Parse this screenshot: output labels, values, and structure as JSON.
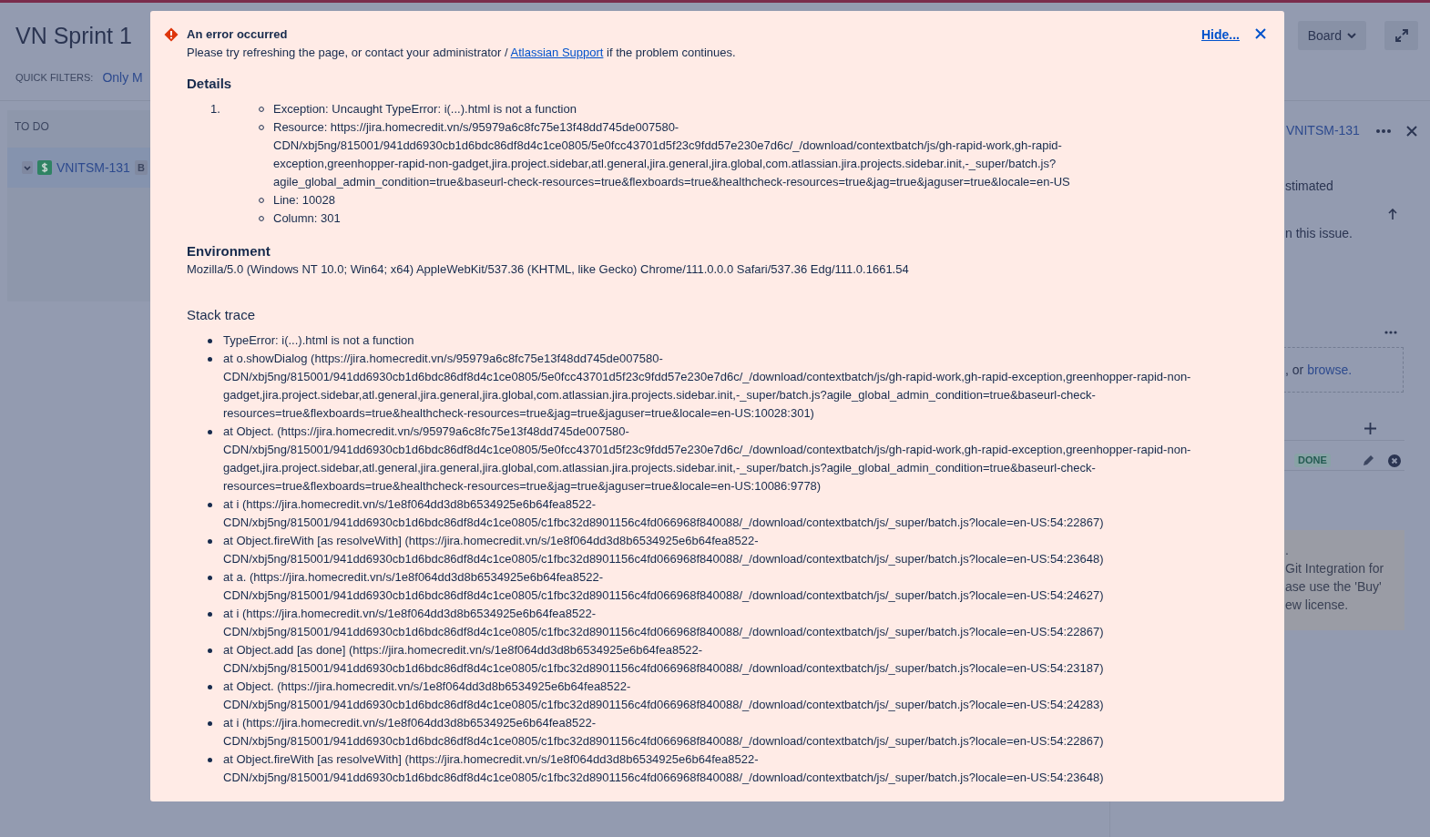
{
  "board": {
    "title": "VN Sprint 1",
    "view_button": "Board",
    "quick_filters_label": "QUICK FILTERS:",
    "quick_filter": "Only M",
    "column": "TO DO",
    "card": {
      "key": "VNITSM-131",
      "badge": "B"
    }
  },
  "detail_panel": {
    "issue_key": "VNITSM-131",
    "estimate_text": "stimated",
    "issue_text": "n this issue.",
    "attach_text": ", or",
    "attach_link": "browse.",
    "status": "DONE",
    "license_lines": [
      ".",
      "Git Integration for",
      "ase use the 'Buy'",
      "ew license."
    ]
  },
  "error": {
    "title": "An error occurred",
    "message_before": "Please try refreshing the page, or contact your administrator /",
    "link": "Atlassian Support",
    "message_after": "if the problem continues.",
    "hide": "Hide...",
    "details_heading": "Details",
    "details": [
      {
        "number": "1.",
        "items": [
          "Exception: Uncaught TypeError: i(...).html is not a function",
          "Resource: https://jira.homecredit.vn/s/95979a6c8fc75e13f48dd745de007580-CDN/xbj5ng/815001/941dd6930cb1d6bdc86df8d4c1ce0805/5e0fcc43701d5f23c9fdd57e230e7d6c/_/download/contextbatch/js/gh-rapid-work,gh-rapid-exception,greenhopper-rapid-non-gadget,jira.project.sidebar,atl.general,jira.general,jira.global,com.atlassian.jira.projects.sidebar.init,-_super/batch.js?agile_global_admin_condition=true&baseurl-check-resources=true&flexboards=true&healthcheck-resources=true&jag=true&jaguser=true&locale=en-US",
          "Line: 10028",
          "Column: 301"
        ]
      }
    ],
    "environment_heading": "Environment",
    "environment": "Mozilla/5.0 (Windows NT 10.0; Win64; x64) AppleWebKit/537.36 (KHTML, like Gecko) Chrome/111.0.0.0 Safari/537.36 Edg/111.0.1661.54",
    "stack_heading": "Stack trace",
    "stack": [
      "TypeError: i(...).html is not a function",
      "at o.showDialog (https://jira.homecredit.vn/s/95979a6c8fc75e13f48dd745de007580-CDN/xbj5ng/815001/941dd6930cb1d6bdc86df8d4c1ce0805/5e0fcc43701d5f23c9fdd57e230e7d6c/_/download/contextbatch/js/gh-rapid-work,gh-rapid-exception,greenhopper-rapid-non-gadget,jira.project.sidebar,atl.general,jira.general,jira.global,com.atlassian.jira.projects.sidebar.init,-_super/batch.js?agile_global_admin_condition=true&baseurl-check-resources=true&flexboards=true&healthcheck-resources=true&jag=true&jaguser=true&locale=en-US:10028:301)",
      "at Object. (https://jira.homecredit.vn/s/95979a6c8fc75e13f48dd745de007580-CDN/xbj5ng/815001/941dd6930cb1d6bdc86df8d4c1ce0805/5e0fcc43701d5f23c9fdd57e230e7d6c/_/download/contextbatch/js/gh-rapid-work,gh-rapid-exception,greenhopper-rapid-non-gadget,jira.project.sidebar,atl.general,jira.general,jira.global,com.atlassian.jira.projects.sidebar.init,-_super/batch.js?agile_global_admin_condition=true&baseurl-check-resources=true&flexboards=true&healthcheck-resources=true&jag=true&jaguser=true&locale=en-US:10086:9778)",
      "at i (https://jira.homecredit.vn/s/1e8f064dd3d8b6534925e6b64fea8522-CDN/xbj5ng/815001/941dd6930cb1d6bdc86df8d4c1ce0805/c1fbc32d8901156c4fd066968f840088/_/download/contextbatch/js/_super/batch.js?locale=en-US:54:22867)",
      "at Object.fireWith [as resolveWith] (https://jira.homecredit.vn/s/1e8f064dd3d8b6534925e6b64fea8522-CDN/xbj5ng/815001/941dd6930cb1d6bdc86df8d4c1ce0805/c1fbc32d8901156c4fd066968f840088/_/download/contextbatch/js/_super/batch.js?locale=en-US:54:23648)",
      "at a. (https://jira.homecredit.vn/s/1e8f064dd3d8b6534925e6b64fea8522-CDN/xbj5ng/815001/941dd6930cb1d6bdc86df8d4c1ce0805/c1fbc32d8901156c4fd066968f840088/_/download/contextbatch/js/_super/batch.js?locale=en-US:54:24627)",
      "at i (https://jira.homecredit.vn/s/1e8f064dd3d8b6534925e6b64fea8522-CDN/xbj5ng/815001/941dd6930cb1d6bdc86df8d4c1ce0805/c1fbc32d8901156c4fd066968f840088/_/download/contextbatch/js/_super/batch.js?locale=en-US:54:22867)",
      "at Object.add [as done] (https://jira.homecredit.vn/s/1e8f064dd3d8b6534925e6b64fea8522-CDN/xbj5ng/815001/941dd6930cb1d6bdc86df8d4c1ce0805/c1fbc32d8901156c4fd066968f840088/_/download/contextbatch/js/_super/batch.js?locale=en-US:54:23187)",
      "at Object. (https://jira.homecredit.vn/s/1e8f064dd3d8b6534925e6b64fea8522-CDN/xbj5ng/815001/941dd6930cb1d6bdc86df8d4c1ce0805/c1fbc32d8901156c4fd066968f840088/_/download/contextbatch/js/_super/batch.js?locale=en-US:54:24283)",
      "at i (https://jira.homecredit.vn/s/1e8f064dd3d8b6534925e6b64fea8522-CDN/xbj5ng/815001/941dd6930cb1d6bdc86df8d4c1ce0805/c1fbc32d8901156c4fd066968f840088/_/download/contextbatch/js/_super/batch.js?locale=en-US:54:22867)",
      "at Object.fireWith [as resolveWith] (https://jira.homecredit.vn/s/1e8f064dd3d8b6534925e6b64fea8522-CDN/xbj5ng/815001/941dd6930cb1d6bdc86df8d4c1ce0805/c1fbc32d8901156c4fd066968f840088/_/download/contextbatch/js/_super/batch.js?locale=en-US:54:23648)"
    ]
  }
}
